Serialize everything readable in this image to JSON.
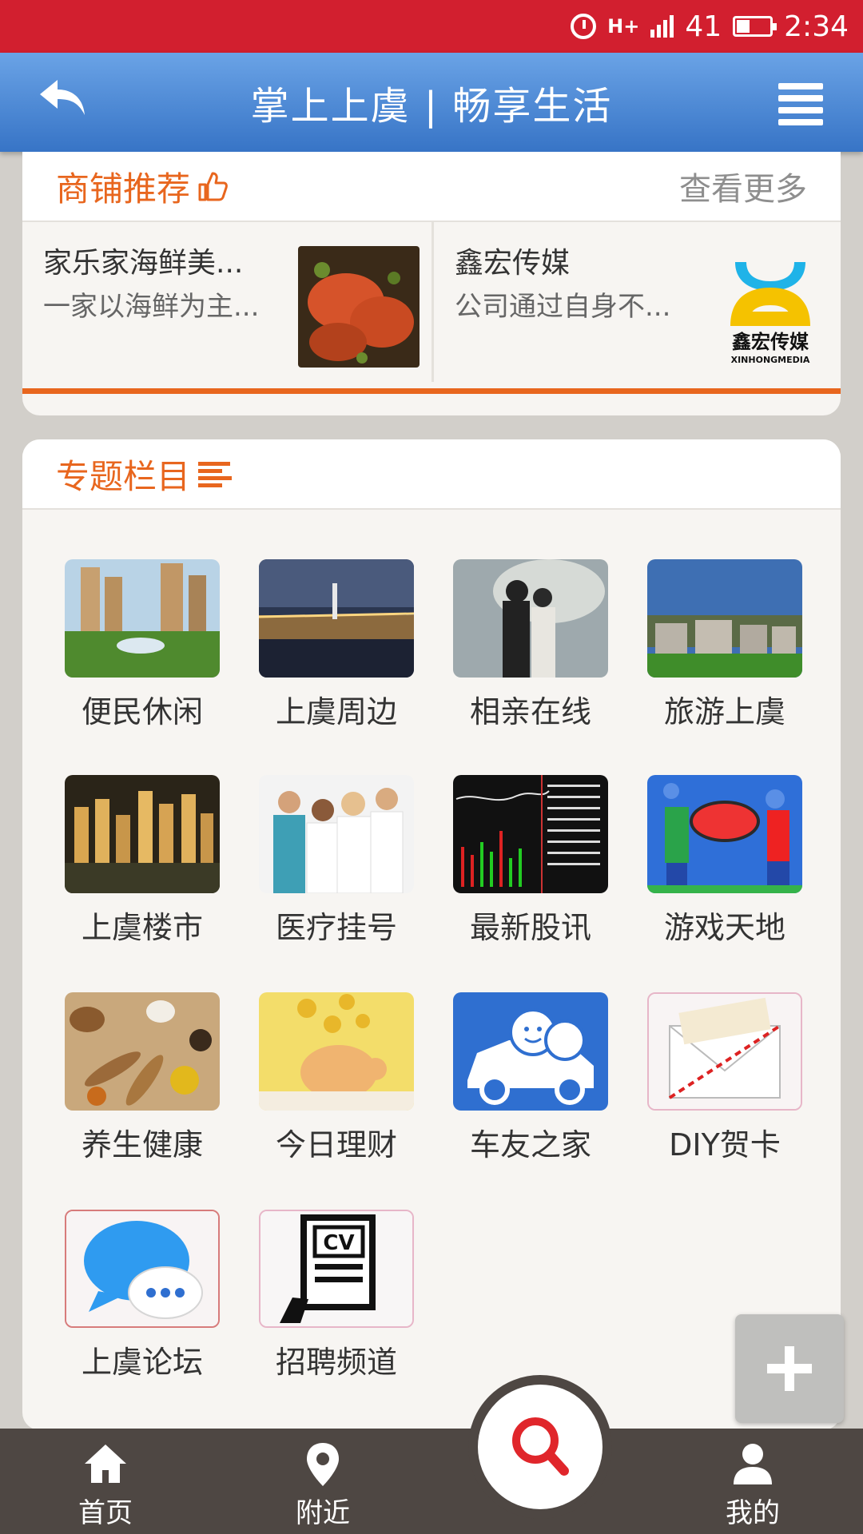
{
  "status_bar": {
    "network": "H+",
    "battery": "41",
    "time": "2:34"
  },
  "header": {
    "title": "掌上上虞 | 畅享生活"
  },
  "shop_section": {
    "title": "商铺推荐",
    "more": "查看更多",
    "items": [
      {
        "name": "家乐家海鲜美...",
        "desc": "一家以海鲜为主..."
      },
      {
        "name": "鑫宏传媒",
        "desc": "公司通过自身不...",
        "logo_text": "鑫宏传媒",
        "logo_sub": "XINHONGMEDIA"
      }
    ]
  },
  "topics_section": {
    "title": "专题栏目",
    "items": [
      {
        "label": "便民休闲"
      },
      {
        "label": "上虞周边"
      },
      {
        "label": "相亲在线"
      },
      {
        "label": "旅游上虞"
      },
      {
        "label": "上虞楼市"
      },
      {
        "label": "医疗挂号"
      },
      {
        "label": "最新股讯"
      },
      {
        "label": "游戏天地"
      },
      {
        "label": "养生健康"
      },
      {
        "label": "今日理财"
      },
      {
        "label": "车友之家"
      },
      {
        "label": "DIY贺卡"
      },
      {
        "label": "上虞论坛"
      },
      {
        "label": "招聘频道"
      }
    ]
  },
  "bottom_nav": {
    "home": "首页",
    "nearby": "附近",
    "mine": "我的"
  },
  "colors": {
    "accent": "#e8661e",
    "header": "#3774c6",
    "status": "#d21f2f",
    "nav": "#4e4743"
  }
}
